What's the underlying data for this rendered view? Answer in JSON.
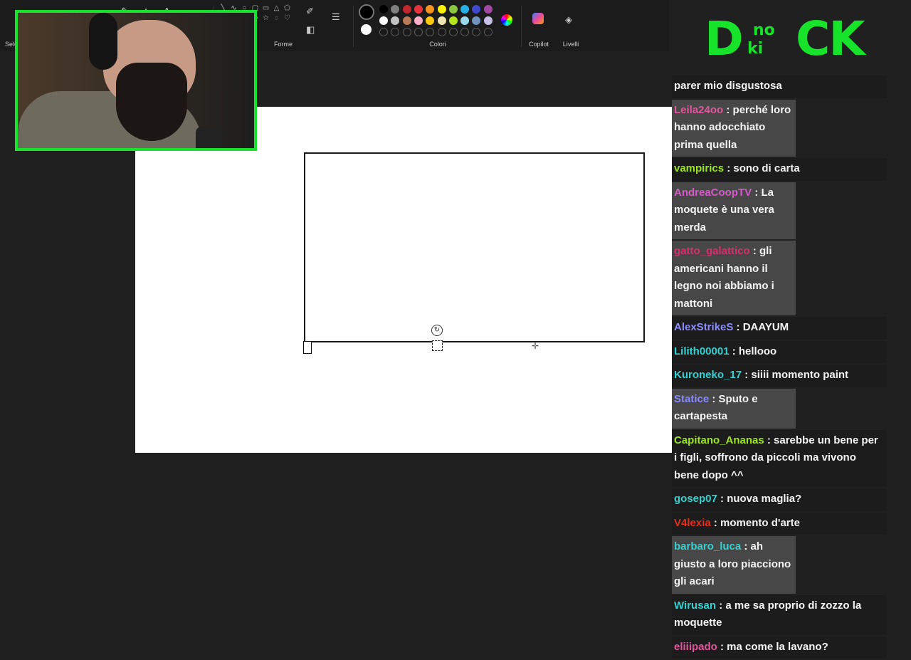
{
  "toolbar": {
    "labels": {
      "selection": "Sele",
      "shapes": "Forme",
      "colors": "Colori",
      "copilot": "Copilot",
      "layers": "Livelli"
    },
    "palette_row1": [
      "#000000",
      "#7f7f7f",
      "#c1272d",
      "#e8333d",
      "#f7941d",
      "#fff200",
      "#8dc63f",
      "#25b0e6",
      "#3f48cc",
      "#a349a4"
    ],
    "palette_row2": [
      "#ffffff",
      "#c3c3c3",
      "#b97a57",
      "#ffaec9",
      "#ffc90e",
      "#efe4b0",
      "#b5e61d",
      "#99d9ea",
      "#7092be",
      "#c8bfe7"
    ],
    "active_color_primary": "#000000",
    "active_color_secondary": "#ffffff"
  },
  "logo": {
    "left": "D",
    "mid_top": "no",
    "mid_bottom": "ki",
    "right": "CK",
    "color": "#16e32a"
  },
  "chat": [
    {
      "user": "",
      "text": "parer mio disgustosa",
      "color": "#ffffff",
      "dark": true
    },
    {
      "user": "Leila24oo",
      "text": " : perché loro hanno adocchiato prima quella",
      "color": "#e0579b",
      "dark": false
    },
    {
      "user": "vampirics",
      "text": " : sono di carta",
      "color": "#9de51c",
      "dark": true
    },
    {
      "user": "AndreaCoopTV",
      "text": " : La moquete è una vera merda",
      "color": "#d65bc9",
      "dark": false
    },
    {
      "user": "gatto_galattico",
      "text": " : gli americani hanno il legno noi abbiamo i mattoni",
      "color": "#d6306b",
      "dark": false
    },
    {
      "user": "AlexStrikeS",
      "text": " : DAAYUM",
      "color": "#8a8aff",
      "dark": true
    },
    {
      "user": "Lilith00001",
      "text": " : hellooo",
      "color": "#35d1d1",
      "dark": true
    },
    {
      "user": "Kuroneko_17",
      "text": " : siiii momento paint",
      "color": "#35d1d1",
      "dark": true
    },
    {
      "user": "Statice",
      "text": " : Sputo e cartapesta",
      "color": "#8a8aff",
      "dark": false
    },
    {
      "user": "Capitano_Ananas",
      "text": " : sarebbe un bene per i figli, soffrono da piccoli ma vivono bene dopo ^^",
      "color": "#9de51c",
      "dark": true
    },
    {
      "user": "gosep07",
      "text": " : nuova maglia?",
      "color": "#35d1d1",
      "dark": true
    },
    {
      "user": "V4lexia",
      "text": " : momento d'arte",
      "color": "#e0301e",
      "dark": true
    },
    {
      "user": "barbaro_luca",
      "text": " : ah giusto a loro piacciono gli acari",
      "color": "#35d1d1",
      "dark": false
    },
    {
      "user": "Wirusan",
      "text": " : a me sa proprio di zozzo la moquette",
      "color": "#35d1d1",
      "dark": true
    },
    {
      "user": "eliiipado",
      "text": " : ma come la lavano?",
      "color": "#e0579b",
      "dark": true
    }
  ]
}
